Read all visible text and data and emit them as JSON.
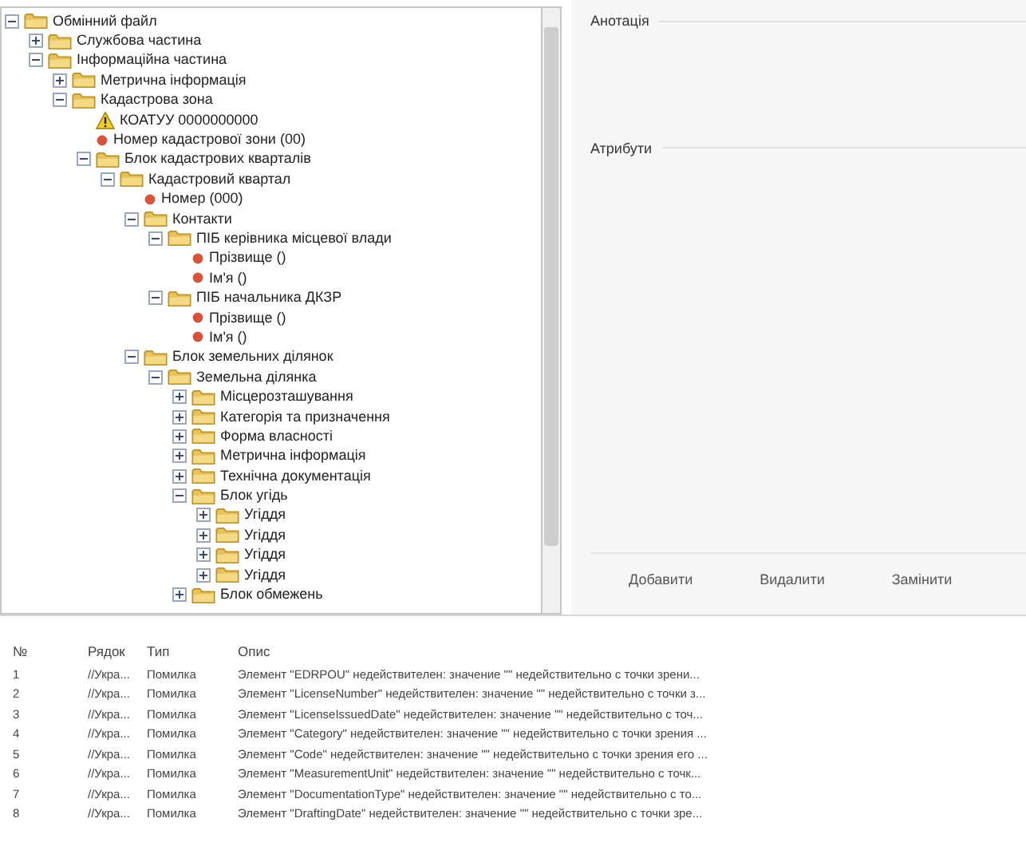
{
  "tree": [
    {
      "label": "Обмінний файл",
      "kind": "folder",
      "expanded": true,
      "children": [
        {
          "label": "Службова частина",
          "kind": "folder",
          "expanded": false
        },
        {
          "label": "Інформаційна частина",
          "kind": "folder",
          "expanded": true,
          "children": [
            {
              "label": "Метрична інформація",
              "kind": "folder",
              "expanded": false
            },
            {
              "label": "Кадастрова зона",
              "kind": "folder",
              "expanded": true,
              "children": [
                {
                  "label": "КОАТУУ 0000000000",
                  "kind": "warning"
                },
                {
                  "label": "Номер кадастрової зони (00)",
                  "kind": "field"
                },
                {
                  "label": "Блок кадастрових кварталів",
                  "kind": "folder",
                  "expanded": true,
                  "children": [
                    {
                      "label": "Кадастровий квартал",
                      "kind": "folder",
                      "expanded": true,
                      "children": [
                        {
                          "label": "Номер (000)",
                          "kind": "field"
                        },
                        {
                          "label": "Контакти",
                          "kind": "folder",
                          "expanded": true,
                          "children": [
                            {
                              "label": "ПІБ керівника місцевої влади",
                              "kind": "folder",
                              "expanded": true,
                              "children": [
                                {
                                  "label": "Прізвище ()",
                                  "kind": "field"
                                },
                                {
                                  "label": "Ім'я ()",
                                  "kind": "field"
                                }
                              ]
                            },
                            {
                              "label": "ПІБ начальника ДКЗР",
                              "kind": "folder",
                              "expanded": true,
                              "children": [
                                {
                                  "label": "Прізвище ()",
                                  "kind": "field"
                                },
                                {
                                  "label": "Ім'я ()",
                                  "kind": "field"
                                }
                              ]
                            }
                          ]
                        },
                        {
                          "label": "Блок земельних ділянок",
                          "kind": "folder",
                          "expanded": true,
                          "children": [
                            {
                              "label": "Земельна ділянка",
                              "kind": "folder",
                              "expanded": true,
                              "children": [
                                {
                                  "label": "Місцерозташування",
                                  "kind": "folder",
                                  "expanded": false
                                },
                                {
                                  "label": "Категорія та призначення",
                                  "kind": "folder",
                                  "expanded": false
                                },
                                {
                                  "label": "Форма власності",
                                  "kind": "folder",
                                  "expanded": false
                                },
                                {
                                  "label": "Метрична інформація",
                                  "kind": "folder",
                                  "expanded": false
                                },
                                {
                                  "label": "Технічна документація",
                                  "kind": "folder",
                                  "expanded": false
                                },
                                {
                                  "label": "Блок угідь",
                                  "kind": "folder",
                                  "expanded": true,
                                  "children": [
                                    {
                                      "label": "Угіддя",
                                      "kind": "folder",
                                      "expanded": false
                                    },
                                    {
                                      "label": "Угіддя",
                                      "kind": "folder",
                                      "expanded": false
                                    },
                                    {
                                      "label": "Угіддя",
                                      "kind": "folder",
                                      "expanded": false
                                    },
                                    {
                                      "label": "Угіддя",
                                      "kind": "folder",
                                      "expanded": false
                                    }
                                  ]
                                },
                                {
                                  "label": "Блок обмежень",
                                  "kind": "folder",
                                  "expanded": false
                                }
                              ]
                            }
                          ]
                        }
                      ]
                    }
                  ]
                }
              ]
            }
          ]
        }
      ]
    }
  ],
  "annotation": {
    "title": "Анотація"
  },
  "attributes": {
    "title": "Атрибути"
  },
  "buttons": [
    "Добавити",
    "Видалити",
    "Замінити"
  ],
  "errors": {
    "columns": [
      "№",
      "Рядок",
      "Тип",
      "Опис"
    ],
    "rows": [
      [
        "1",
        "//Укра...",
        "Помилка",
        "Элемент \"EDRPOU\" недействителен: значение \"\" недействительно с точки зрени..."
      ],
      [
        "2",
        "//Укра...",
        "Помилка",
        "Элемент \"LicenseNumber\" недействителен: значение \"\" недействительно с точки з..."
      ],
      [
        "3",
        "//Укра...",
        "Помилка",
        "Элемент \"LicenseIssuedDate\" недействителен: значение \"\" недействительно с точ..."
      ],
      [
        "4",
        "//Укра...",
        "Помилка",
        "Элемент \"Category\" недействителен: значение \"\" недействительно с точки зрения ..."
      ],
      [
        "5",
        "//Укра...",
        "Помилка",
        "Элемент \"Code\" недействителен: значение \"\" недействительно с точки зрения его ..."
      ],
      [
        "6",
        "//Укра...",
        "Помилка",
        "Элемент \"MeasurementUnit\" недействителен: значение \"\" недействительно с точк..."
      ],
      [
        "7",
        "//Укра...",
        "Помилка",
        "Элемент \"DocumentationType\" недействителен: значение \"\" недействительно с то..."
      ],
      [
        "8",
        "//Укра...",
        "Помилка",
        "Элемент \"DraftingDate\" недействителен: значение \"\" недействительно с точки зре..."
      ]
    ]
  }
}
